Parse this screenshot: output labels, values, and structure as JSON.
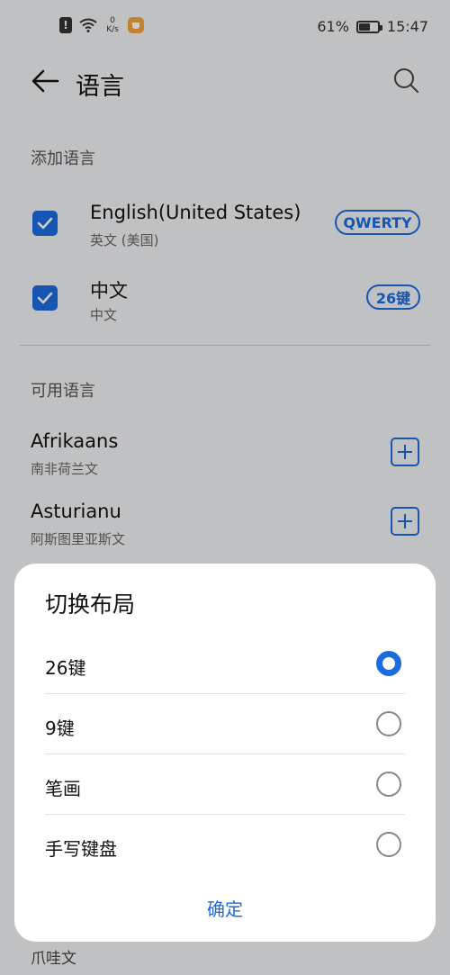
{
  "status_bar": {
    "network_speed": "0\nK/s",
    "battery_percent": "61%",
    "battery_level": 0.61,
    "time": "15:47"
  },
  "header": {
    "title": "语言"
  },
  "added_section": {
    "title": "添加语言",
    "languages": [
      {
        "name": "English(United States)",
        "sub": "英文 (美国)",
        "layout": "QWERTY",
        "checked": true
      },
      {
        "name": "中文",
        "sub": "中文",
        "layout": "26键",
        "checked": true
      }
    ]
  },
  "available_section": {
    "title": "可用语言",
    "languages": [
      {
        "name": "Afrikaans",
        "sub": "南非荷兰文"
      },
      {
        "name": "Asturianu",
        "sub": "阿斯图里亚斯文"
      }
    ],
    "peek_text": "爪哇文"
  },
  "dialog": {
    "title": "切换布局",
    "options": [
      {
        "label": "26键",
        "selected": true
      },
      {
        "label": "9键",
        "selected": false
      },
      {
        "label": "笔画",
        "selected": false
      },
      {
        "label": "手写键盘",
        "selected": false
      }
    ],
    "confirm_label": "确定"
  },
  "colors": {
    "accent": "#1d6be0",
    "background": "#f1f2f4",
    "dialog_bg": "#ffffff"
  }
}
